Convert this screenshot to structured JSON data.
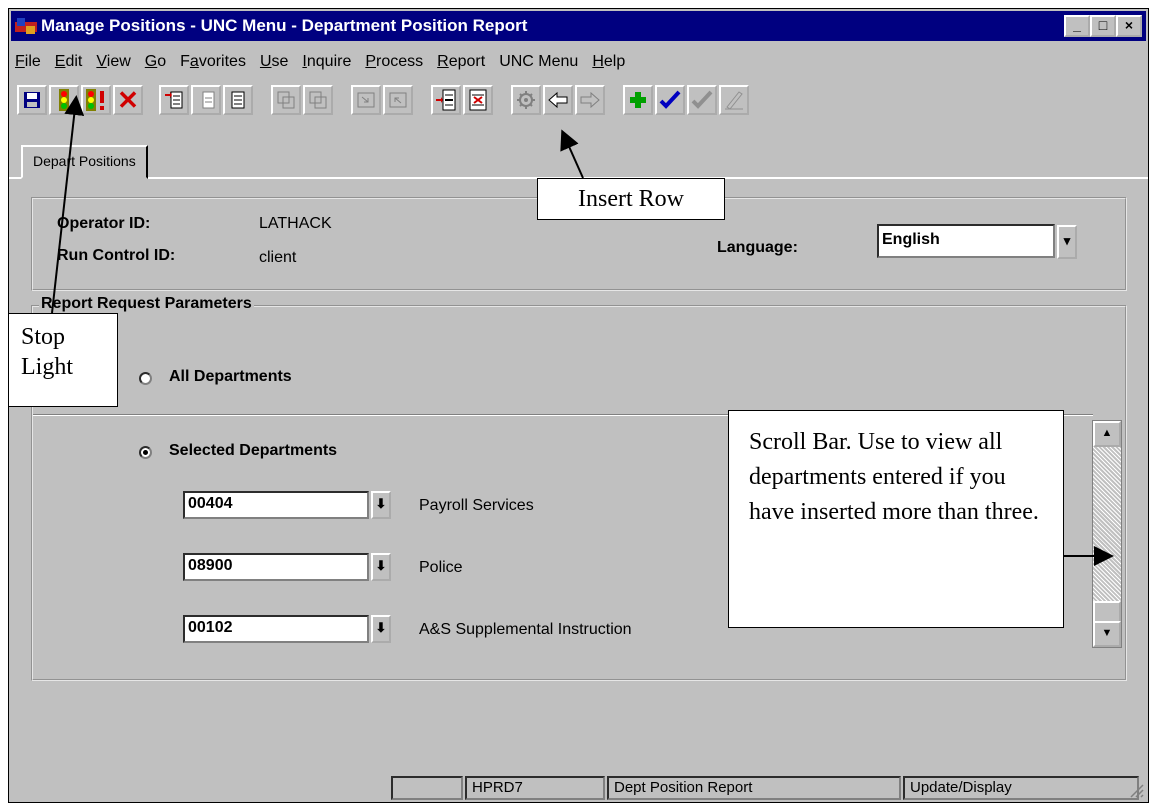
{
  "window": {
    "title": "Manage Positions - UNC Menu - Department Position Report",
    "buttons": {
      "minimize": "_",
      "maximize": "□",
      "close": "×"
    }
  },
  "menu": [
    {
      "label": "File",
      "accel": "F",
      "rest": "ile"
    },
    {
      "label": "Edit",
      "accel": "E",
      "rest": "dit"
    },
    {
      "label": "View",
      "accel": "V",
      "rest": "iew"
    },
    {
      "label": "Go",
      "accel": "G",
      "rest": "o"
    },
    {
      "label": "Favorites",
      "pre": "F",
      "accel": "a",
      "rest": "vorites"
    },
    {
      "label": "Use",
      "accel": "U",
      "rest": "se"
    },
    {
      "label": "Inquire",
      "accel": "I",
      "rest": "nquire"
    },
    {
      "label": "Process",
      "accel": "P",
      "rest": "rocess"
    },
    {
      "label": "Report",
      "accel": "R",
      "rest": "eport"
    },
    {
      "label": "UNC Menu",
      "accel": "",
      "rest": "UNC Menu"
    },
    {
      "label": "Help",
      "accel": "H",
      "rest": "elp"
    }
  ],
  "toolbar_icons": [
    "save-icon",
    "stoplight-icon",
    "stoplight-alert-icon",
    "delete-icon",
    "insert-first-icon",
    "insert-next-icon",
    "list-icon",
    "copy-icon",
    "paste-icon",
    "next-icon",
    "prev-icon",
    "insert-row-icon",
    "delete-row-icon",
    "refresh-icon",
    "back-icon",
    "forward-icon",
    "add-icon",
    "save-check-icon",
    "check-add-icon",
    "edit-icon"
  ],
  "tab": {
    "label": "Depart Positions"
  },
  "header": {
    "operator_label": "Operator ID:",
    "operator_value": "LATHACK",
    "run_control_label": "Run Control ID:",
    "run_control_value": "client",
    "language_label": "Language:",
    "language_value": "English"
  },
  "report": {
    "group_title": "Report Request Parameters",
    "all_label": "All Departments",
    "selected_label": "Selected Departments",
    "selected_option": "Selected Departments",
    "departments": [
      {
        "code": "00404",
        "name": "Payroll Services"
      },
      {
        "code": "08900",
        "name": "Police"
      },
      {
        "code": "00102",
        "name": "A&S Supplemental Instruction"
      }
    ]
  },
  "callouts": {
    "insert_row": "Insert Row",
    "stop_light": "Stop Light",
    "scroll_bar": "Scroll Bar.  Use to view all departments entered if you have inserted more than three."
  },
  "status": {
    "database": "HPRD7",
    "page": "Dept Position Report",
    "mode": "Update/Display"
  },
  "colors": {
    "titlebar": "#000080",
    "face": "#c0c0c0",
    "add": "#00a000",
    "check": "#0000c0",
    "delete": "#d00000"
  }
}
